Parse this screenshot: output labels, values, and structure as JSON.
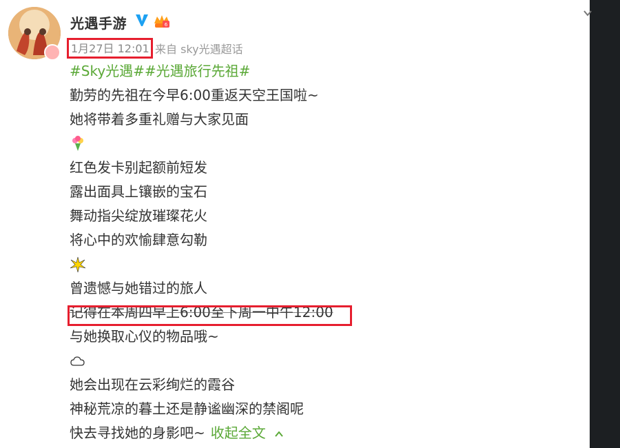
{
  "post": {
    "author": "光遇手游",
    "date": "1月27日 12:01",
    "source": "来自 sky光遇超话",
    "hashtags": "#Sky光遇##光遇旅行先祖#",
    "lines": [
      "勤劳的先祖在今早6:00重返天空王国啦~",
      "她将带着多重礼赠与大家见面",
      "红色发卡别起额前短发",
      "露出面具上镶嵌的宝石",
      "舞动指尖绽放璀璨花火",
      "将心中的欢愉肆意勾勒",
      "曾遗憾与她错过的旅人",
      "记得在本周四早上6:00至下周一中午12:00",
      "与她换取心仪的物品哦~",
      "她会出现在云彩绚烂的霞谷",
      "神秘荒凉的暮土还是静谧幽深的禁阁呢",
      "快去寻找她的身影吧~"
    ],
    "collapse_label": "收起全文",
    "emojis": [
      "bouquet-icon",
      "sparkle-burst-icon",
      "cloud-icon"
    ]
  },
  "colors": {
    "accent_green": "#5aa836",
    "highlight_red": "#e61e2e",
    "text": "#333333",
    "muted": "#888888"
  }
}
